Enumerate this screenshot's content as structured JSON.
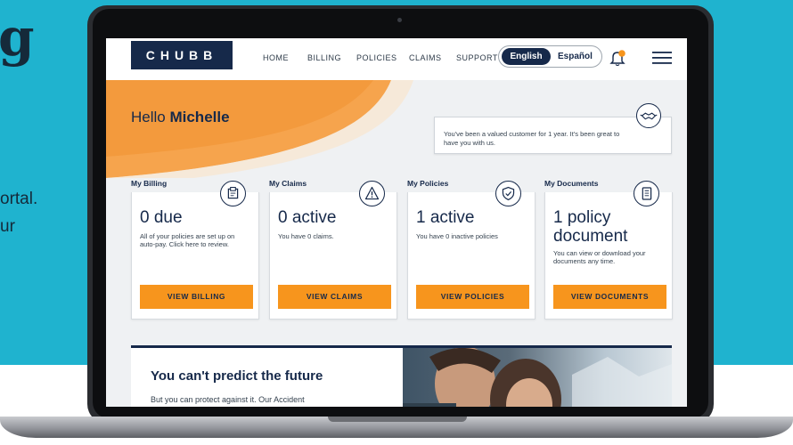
{
  "side": {
    "big_letter": "g",
    "line1": "ortal.",
    "line2": "ur"
  },
  "nav": {
    "logo": "CHUBB",
    "links": [
      "HOME",
      "BILLING",
      "POLICIES",
      "CLAIMS",
      "SUPPORT"
    ],
    "lang_active": "English",
    "lang_other": "Español"
  },
  "hero": {
    "greeting": "Hello ",
    "name": "Michelle",
    "valued_text": "You've been a valued customer for 1 year. It's been great to have you with us."
  },
  "cards": [
    {
      "title": "My Billing",
      "big": "0 due",
      "small": "All of your policies are set up on auto-pay. Click here to review.",
      "button": "VIEW BILLING",
      "icon": "billing-icon"
    },
    {
      "title": "My Claims",
      "big": "0 active",
      "small": "You have 0 claims.",
      "button": "VIEW CLAIMS",
      "icon": "warning-icon"
    },
    {
      "title": "My Policies",
      "big": "1 active",
      "small": "You have 0 inactive policies",
      "button": "VIEW POLICIES",
      "icon": "shield-check-icon"
    },
    {
      "title": "My Documents",
      "big": "1 policy document",
      "small": "You can view or download your documents any time.",
      "button": "VIEW DOCUMENTS",
      "icon": "document-icon"
    }
  ],
  "promo": {
    "title": "You can't predict the future",
    "text": "But you can protect against it. Our Accident"
  },
  "colors": {
    "navy": "#16294a",
    "orange": "#f7951d",
    "teal": "#1fb3cf"
  }
}
